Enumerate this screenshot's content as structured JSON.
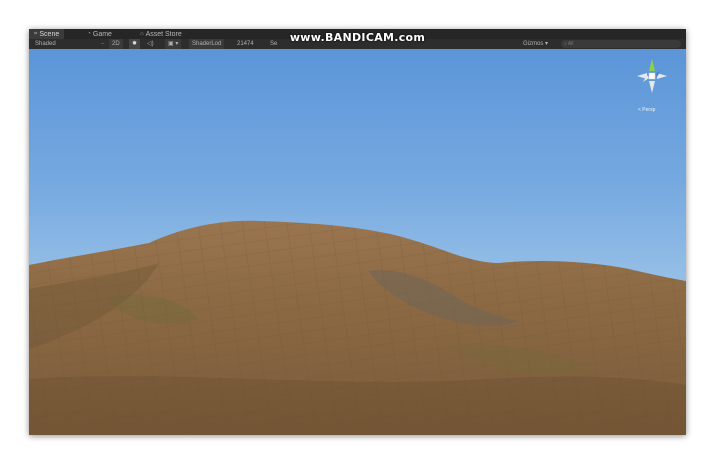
{
  "window": {
    "tabs": [
      {
        "label": "Scene",
        "icon": "scene-icon"
      },
      {
        "label": "Game",
        "icon": "game-icon"
      },
      {
        "label": "Asset Store",
        "icon": "store-icon"
      }
    ],
    "watermark": "www.BANDICAM.com"
  },
  "toolbar": {
    "draw_mode": "Shaded",
    "mode_2d": "2D",
    "lighting_icon": "sun-icon",
    "audio_icon": "speaker-icon",
    "effects_icon": "image-icon",
    "shader_lod_label": "ShaderLod",
    "shader_lod_value": "21474",
    "overflow_label": "Se",
    "gizmos_label": "Gizmos",
    "search_placeholder": "All"
  },
  "viewport": {
    "projection_label": "< Persp",
    "colors": {
      "sky_top": "#5b95d8",
      "sky_bottom": "#c2dcef",
      "terrain": "#8a6640"
    }
  }
}
